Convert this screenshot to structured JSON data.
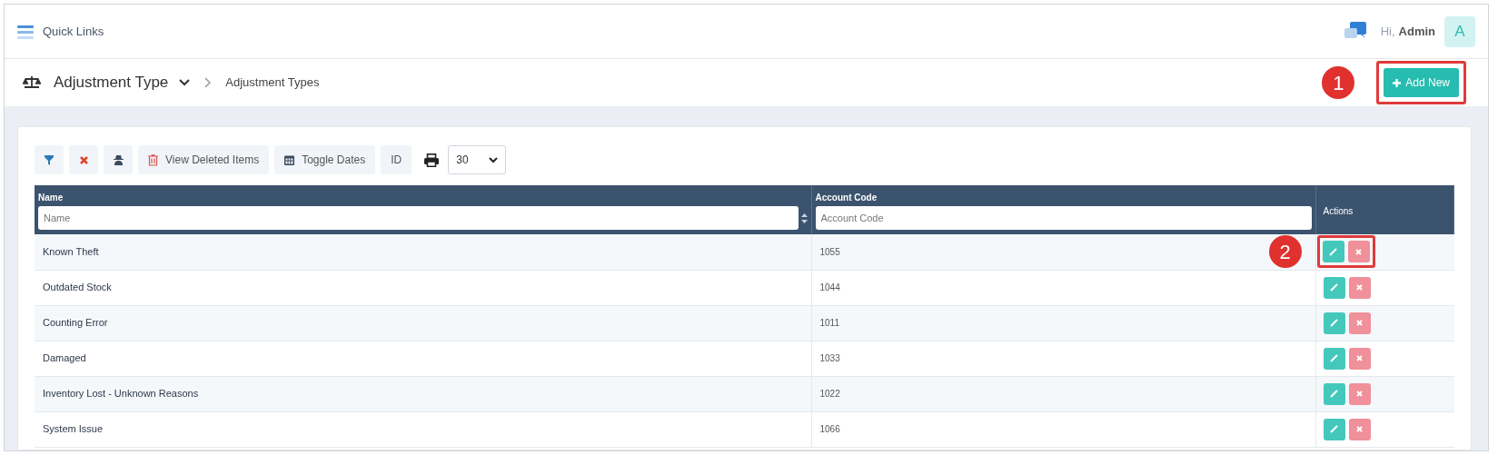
{
  "topbar": {
    "quick_links": "Quick Links",
    "greeting": "Hi,",
    "user": "Admin",
    "avatar": "A"
  },
  "header": {
    "title": "Adjustment Type",
    "breadcrumb": "Adjustment Types",
    "add_button": "Add New",
    "callout": "1"
  },
  "toolbar": {
    "buttons": [
      {
        "kind": "filter"
      },
      {
        "kind": "clear"
      },
      {
        "kind": "user"
      },
      {
        "kind": "deleted",
        "label": "View Deleted Items"
      },
      {
        "kind": "dates",
        "label": "Toggle Dates"
      },
      {
        "kind": "text",
        "label": "ID"
      }
    ],
    "page_size": "30"
  },
  "table": {
    "columns": [
      {
        "label": "Name",
        "placeholder": "Name",
        "sortable": true
      },
      {
        "label": "Account Code",
        "placeholder": "Account Code",
        "sortable": false
      },
      {
        "label": "Actions"
      }
    ],
    "rows": [
      {
        "name": "Known Theft",
        "code": "1055",
        "callout": "2"
      },
      {
        "name": "Outdated Stock",
        "code": "1044"
      },
      {
        "name": "Counting Error",
        "code": "1011"
      },
      {
        "name": "Damaged",
        "code": "1033"
      },
      {
        "name": "Inventory Lost - Unknown Reasons",
        "code": "1022"
      },
      {
        "name": "System Issue",
        "code": "1066"
      }
    ]
  }
}
